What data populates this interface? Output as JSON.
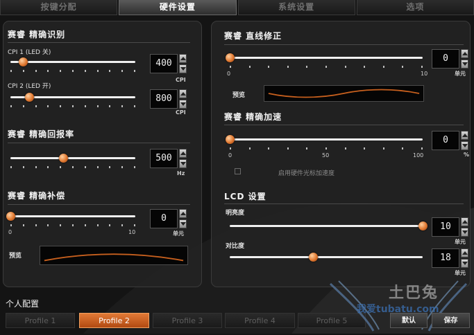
{
  "tabs": [
    {
      "label": "按键分配",
      "active": false
    },
    {
      "label": "硬件设置",
      "active": true
    },
    {
      "label": "系统设置",
      "active": false
    },
    {
      "label": "选项",
      "active": false
    }
  ],
  "left_panel": {
    "cpi": {
      "title": "赛睿 精确识别",
      "cpi1": {
        "label": "CPI 1 (LED 关)",
        "value": "400",
        "unit": "CPI",
        "level": 0.1
      },
      "cpi2": {
        "label": "CPI 2 (LED 开)",
        "value": "800",
        "unit": "CPI",
        "level": 0.15
      }
    },
    "report_rate": {
      "title": "赛睿 精确回报率",
      "value": "500",
      "unit": "Hz",
      "level": 0.42
    },
    "compensation": {
      "title": "赛睿 精确补偿",
      "value": "0",
      "unit": "单元",
      "min": "0",
      "max": "10",
      "level": 0.0,
      "preview_label": "预览"
    }
  },
  "right_panel": {
    "straightening": {
      "title": "赛睿 直线修正",
      "value": "0",
      "unit": "单元",
      "min": "0",
      "max": "10",
      "level": 0.0,
      "preview_label": "预览"
    },
    "acceleration": {
      "title": "赛睿 精确加速",
      "value": "0",
      "unit": "%",
      "min": "0",
      "mid": "50",
      "max": "100",
      "level": 0.0,
      "checkbox_label": "启用硬件光标加速度",
      "checkbox_checked": false
    },
    "lcd": {
      "title": "LCD 设置",
      "brightness": {
        "label": "明亮度",
        "value": "10",
        "unit": "单元",
        "level": 1.0
      },
      "contrast": {
        "label": "对比度",
        "value": "18",
        "unit": "单元",
        "level": 0.43
      }
    }
  },
  "profiles": {
    "label": "个人配置",
    "items": [
      {
        "label": "Profile 1",
        "active": false
      },
      {
        "label": "Profile 2",
        "active": true
      },
      {
        "label": "Profile 3",
        "active": false
      },
      {
        "label": "Profile 4",
        "active": false
      },
      {
        "label": "Profile 5",
        "active": false
      }
    ],
    "default_label": "默认",
    "save_label": "保存"
  },
  "watermark": {
    "cn_name": "土巴兔",
    "text": "我爱tubatu.com"
  },
  "colors": {
    "accent": "#e07830",
    "active_profile": "#c85a20",
    "panel": "#222222"
  }
}
